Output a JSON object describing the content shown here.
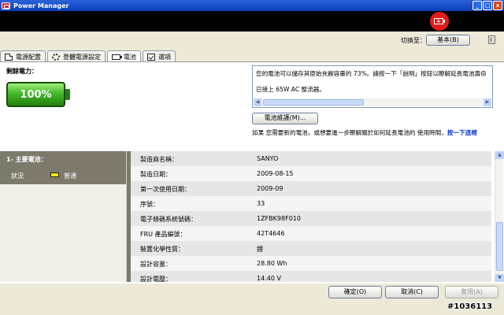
{
  "window": {
    "title": "Power Manager",
    "minimize": "_",
    "maximize": "□",
    "close": "x"
  },
  "header": {
    "switch_label": "切換至：",
    "switch_button": "基本(B)"
  },
  "tabs": [
    {
      "label": "電源配置"
    },
    {
      "label": "登體電源設定"
    },
    {
      "label": "電池"
    },
    {
      "label": "選項"
    }
  ],
  "battery_summary": {
    "label": "剩餘電力：",
    "percent_text": "100%",
    "level": 1.0
  },
  "info_box": {
    "line1": "您的電池可以儲存其原始充飽容量的 73%。請按一下「說明」按鈕以瞭解延長電池壽命",
    "line2": "已接上 65W AC 整流器。"
  },
  "maintenance_button": "電池維護(M)...",
  "recommend": {
    "text": "如果 您需要新的電池，或想要進一步瞭解關於如何延長電池的 使用時間，",
    "link": "按一下這裡"
  },
  "battery_list": {
    "header": "1- 主要電池：",
    "status_label": "狀況",
    "status_value": "普通"
  },
  "details": [
    {
      "key": "製造商名稱：",
      "value": "SANYO"
    },
    {
      "key": "製造日期：",
      "value": "2009-08-15"
    },
    {
      "key": "第一次使用日期：",
      "value": "2009-09"
    },
    {
      "key": "序號：",
      "value": "33"
    },
    {
      "key": "電子條碼系統號碼：",
      "value": "1ZFBK98F010"
    },
    {
      "key": "FRU 產品編號：",
      "value": "42T4646"
    },
    {
      "key": "裝置化學性質：",
      "value": "鋰"
    },
    {
      "key": "設計容量：",
      "value": "28.80 Wh"
    },
    {
      "key": "設計電壓：",
      "value": "14.40 V"
    }
  ],
  "footer": {
    "ok": "確定(O)",
    "cancel": "取消(C)",
    "apply": "套用(A)"
  },
  "watermark": "#1036113",
  "colors": {
    "titlebar": "#0a3fb8",
    "badge": "#e31b1b",
    "battery_green": "#44b82a",
    "link": "#0033cc"
  }
}
